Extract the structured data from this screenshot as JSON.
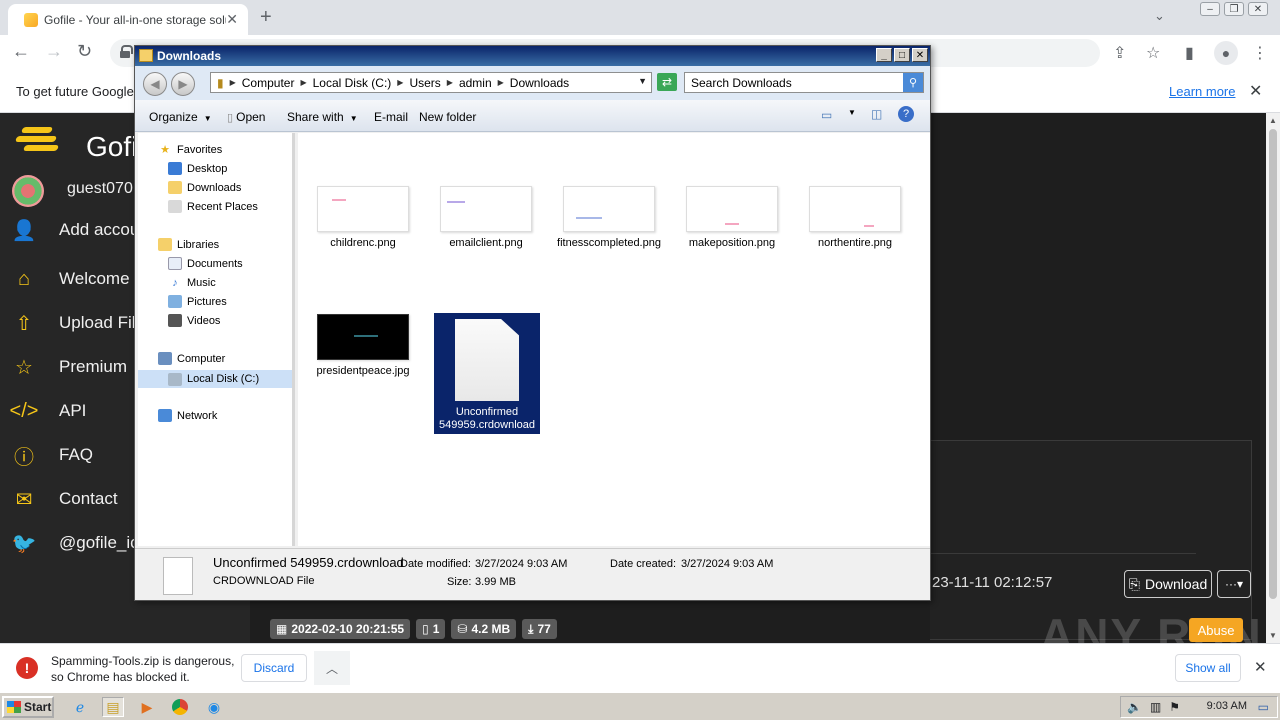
{
  "browser": {
    "tab_title": "Gofile - Your all-in-one storage soluti",
    "infobar_message": "To get future Google",
    "learn_more": "Learn more"
  },
  "gofile": {
    "brand": "Gofi",
    "username": "guest070",
    "menu": [
      {
        "label": "Add accou",
        "icon": "add-user-icon"
      },
      {
        "label": "Welcome",
        "icon": "home-icon"
      },
      {
        "label": "Upload File",
        "icon": "upload-icon"
      },
      {
        "label": "Premium",
        "icon": "star-icon"
      },
      {
        "label": "API",
        "icon": "code-icon"
      },
      {
        "label": "FAQ",
        "icon": "question-icon"
      },
      {
        "label": "Contact",
        "icon": "mail-icon"
      },
      {
        "label": "@gofile_ic",
        "icon": "twitter-icon"
      }
    ],
    "file_date": "23-11-11 02:12:57",
    "download_label": "Download",
    "abuse_label": "Abuse",
    "badges": {
      "created": "2022-02-10 20:21:55",
      "files": "1",
      "size": "4.2 MB",
      "downloads": "77"
    },
    "watermark": "ANY RUN"
  },
  "explorer": {
    "title": "Downloads",
    "breadcrumb": [
      "Computer",
      "Local Disk (C:)",
      "Users",
      "admin",
      "Downloads"
    ],
    "search_placeholder": "Search Downloads",
    "commands": {
      "organize": "Organize",
      "open": "Open",
      "share_with": "Share with",
      "email": "E-mail",
      "new_folder": "New folder"
    },
    "nav": {
      "favorites": "Favorites",
      "desktop": "Desktop",
      "downloads": "Downloads",
      "recent": "Recent Places",
      "libraries": "Libraries",
      "documents": "Documents",
      "music": "Music",
      "pictures": "Pictures",
      "videos": "Videos",
      "computer": "Computer",
      "local_disk": "Local Disk (C:)",
      "network": "Network"
    },
    "files": [
      {
        "name": "childrenc.png"
      },
      {
        "name": "emailclient.png"
      },
      {
        "name": "fitnesscompleted.png"
      },
      {
        "name": "makeposition.png"
      },
      {
        "name": "northentire.png"
      },
      {
        "name": "presidentpeace.jpg"
      },
      {
        "name": "Unconfirmed 549959.crdownload"
      }
    ],
    "details": {
      "name": "Unconfirmed 549959.crdownload",
      "type": "CRDOWNLOAD File",
      "modified_label": "Date modified:",
      "modified": "3/27/2024 9:03 AM",
      "created_label": "Date created:",
      "created": "3/27/2024 9:03 AM",
      "size_label": "Size:",
      "size": "3.99 MB"
    }
  },
  "download_bar": {
    "message_line1": "Spamming-Tools.zip is dangerous,",
    "message_line2": "so Chrome has blocked it.",
    "discard": "Discard",
    "show_all": "Show all"
  },
  "taskbar": {
    "start": "Start",
    "clock": "9:03 AM"
  },
  "colors": {
    "gofile_accent": "#f5c518",
    "selection": "#0a246a",
    "chrome_link": "#1a73e8"
  }
}
